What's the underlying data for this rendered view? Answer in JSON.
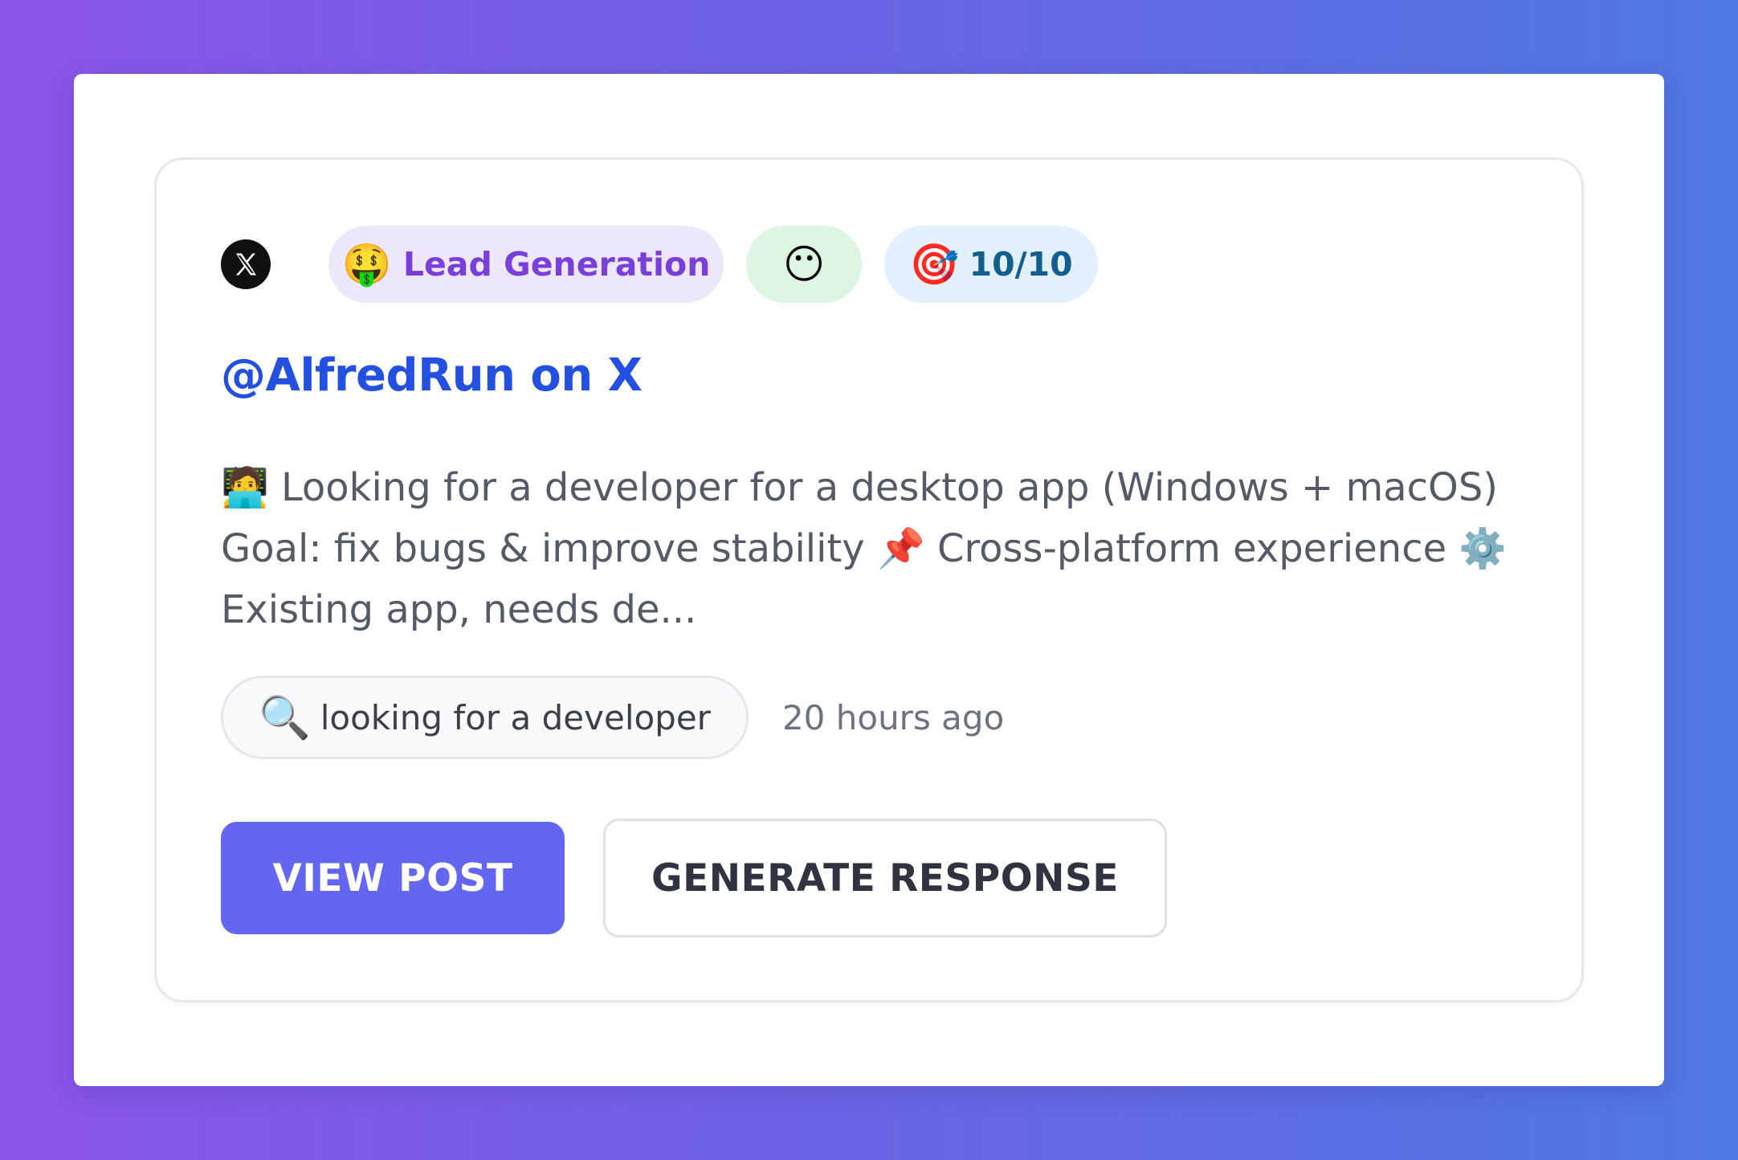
{
  "card": {
    "platform_icon": "x-logo-icon",
    "category_emoji": "🤑",
    "category_label": "Lead Generation",
    "sentiment_emoji": "😶",
    "score_emoji": "🎯",
    "score_label": "10/10",
    "title": "@AlfredRun on X",
    "body": "🧑‍💻 Looking for a developer for a desktop app (Windows + macOS)\nGoal: fix bugs & improve stability 📌 Cross-platform experience ⚙️\nExisting app, needs de...",
    "keyword_emoji": "🔍",
    "keyword_label": "looking for a developer",
    "timestamp": "20 hours ago",
    "view_button_label": "VIEW POST",
    "generate_button_label": "GENERATE RESPONSE"
  },
  "colors": {
    "primary_button": "#6366f1",
    "title_link": "#2350e0",
    "category_pill_bg": "#ede7fb",
    "category_pill_text": "#7a3fdb",
    "sentiment_pill_bg": "#dcf6e2",
    "score_pill_bg": "#e3f0fd",
    "score_pill_text": "#125f8f"
  }
}
